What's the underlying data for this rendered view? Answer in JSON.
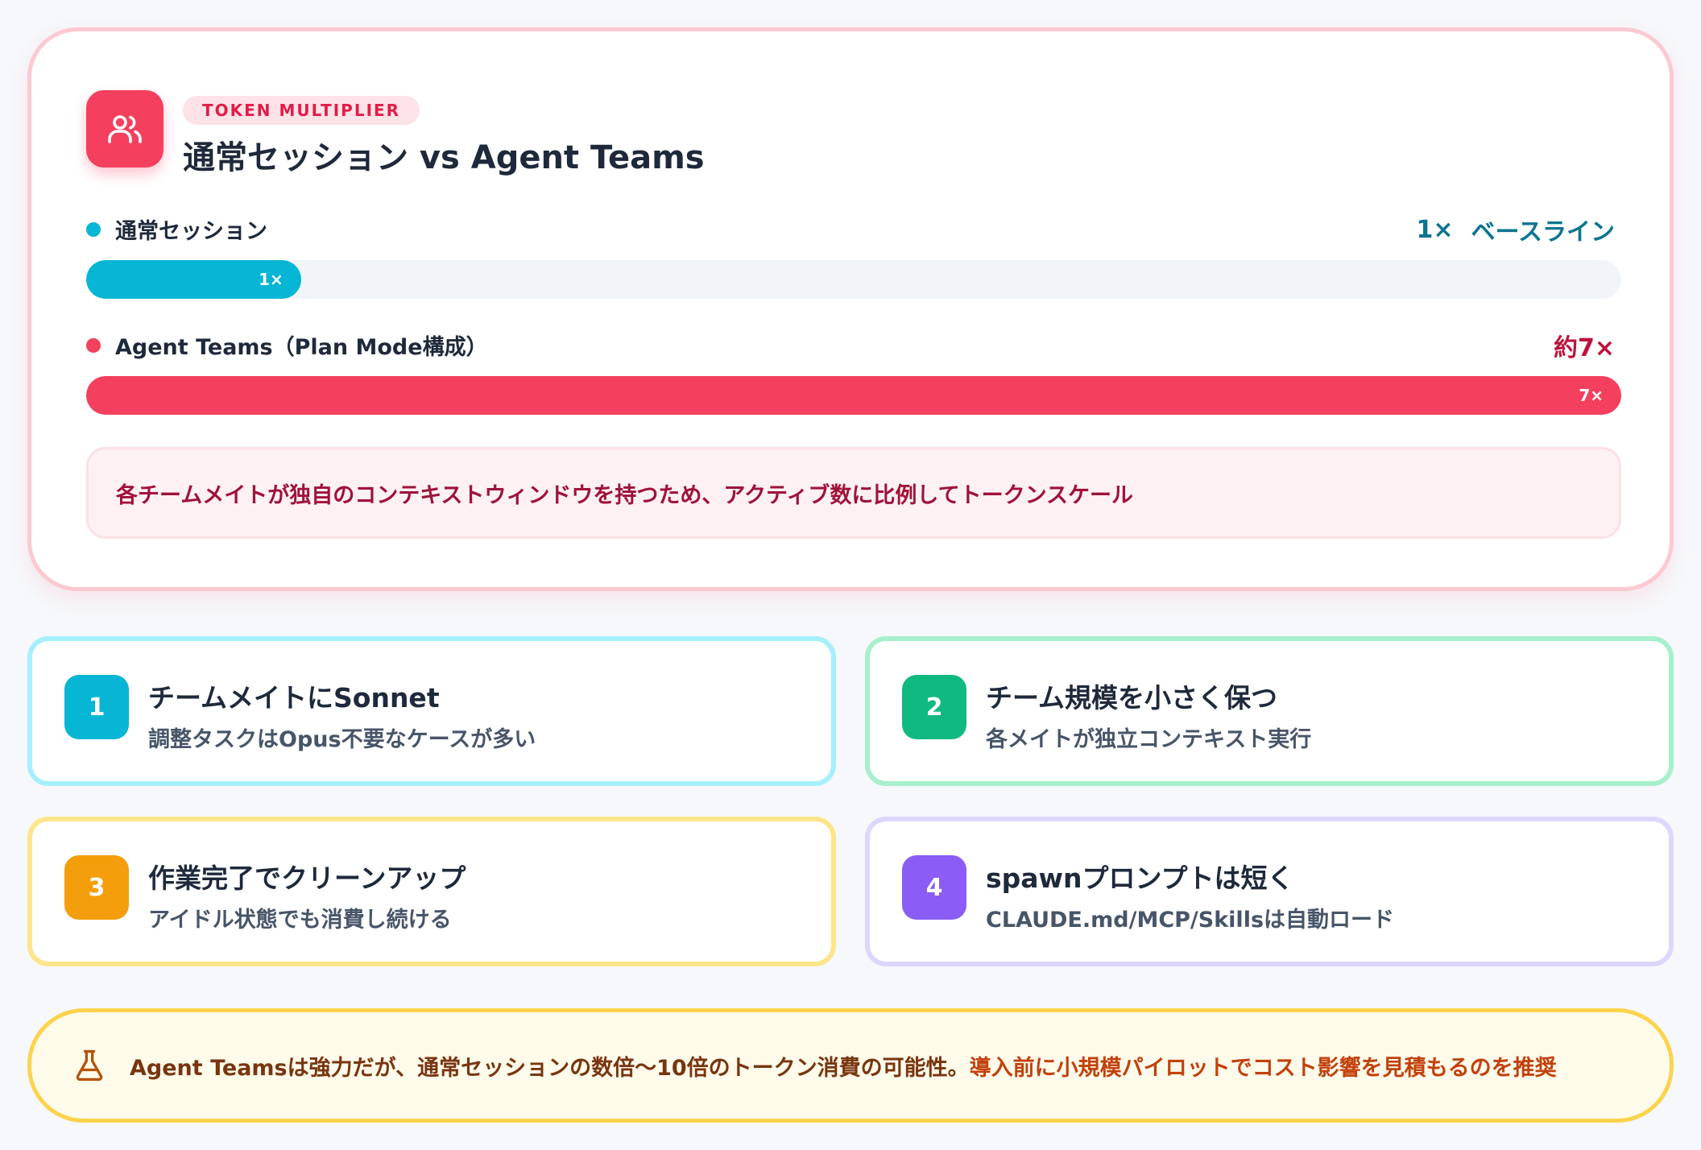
{
  "header": {
    "tag": "TOKEN MULTIPLIER",
    "title": "通常セッション vs Agent Teams",
    "icon": "users-icon"
  },
  "comparison": [
    {
      "label": "通常セッション",
      "value": "1×",
      "value_note": "ベースライン",
      "bar_label": "1×",
      "ratio": 0.14,
      "color": "#06b6d4",
      "value_color": "#0e7490"
    },
    {
      "label": "Agent Teams（Plan Mode構成）",
      "value": "約7×",
      "value_note": "",
      "bar_label": "7×",
      "ratio": 1.0,
      "color": "#f43f5e",
      "value_color": "#be123c"
    }
  ],
  "note": "各チームメイトが独自のコンテキストウィンドウを持つため、アクティブ数に比例してトークンスケール",
  "tips": [
    {
      "num": "1",
      "title": "チームメイトにSonnet",
      "sub": "調整タスクはOpus不要なケースが多い",
      "color": "#06b6d4",
      "border": "#a5f0fc"
    },
    {
      "num": "2",
      "title": "チーム規模を小さく保つ",
      "sub": "各メイトが独立コンテキスト実行",
      "color": "#10b981",
      "border": "#a7f0cd"
    },
    {
      "num": "3",
      "title": "作業完了でクリーンアップ",
      "sub": "アイドル状態でも消費し続ける",
      "color": "#f59e0b",
      "border": "#fde58a"
    },
    {
      "num": "4",
      "title": "spawnプロンプトは短く",
      "sub": "CLAUDE.md/MCP/Skillsは自動ロード",
      "color": "#8b5cf6",
      "border": "#ddd6fe"
    }
  ],
  "warning": {
    "icon": "flask-icon",
    "text_a": "Agent Teamsは強力だが、通常セッションの数倍〜10倍のトークン消費の可能性。",
    "text_b": "導入前に小規模パイロットでコスト影響を見積もるのを推奨"
  }
}
